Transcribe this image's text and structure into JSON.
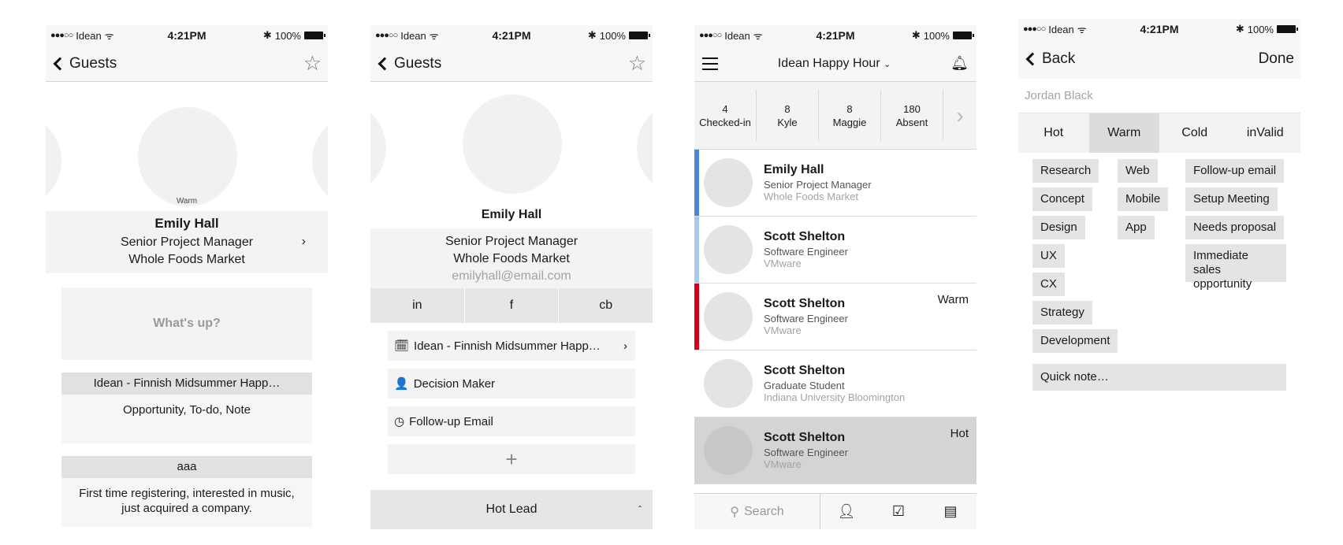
{
  "status": {
    "carrier": "Idean",
    "time": "4:21PM",
    "battery": "100%",
    "dots": "●●●○○"
  },
  "screen1": {
    "back_label": "Guests",
    "temperature_label": "Warm",
    "name": "Emily Hall",
    "title": "Senior Project Manager",
    "company": "Whole Foods Market",
    "whatsup": "What's up?",
    "event_card": {
      "head": "Idean - Finnish Midsummer Happ…",
      "body": "Opportunity, To-do, Note"
    },
    "note_card": {
      "head": "aaa",
      "body": "First time registering, interested in music, just acquired a company."
    }
  },
  "screen2": {
    "back_label": "Guests",
    "name": "Emily Hall",
    "title": "Senior Project Manager",
    "company": "Whole Foods Market",
    "email": "emilyhall@email.com",
    "social": [
      "in",
      "f",
      "cb"
    ],
    "rows": [
      {
        "icon": "calendar-icon",
        "glyph": "🗓",
        "label": "Idean - Finnish Midsummer Happ…"
      },
      {
        "icon": "person-icon",
        "glyph": "👤",
        "label": "Decision Maker"
      },
      {
        "icon": "clock-icon",
        "glyph": "◷",
        "label": "Follow-up Email"
      }
    ],
    "plus": "+",
    "bottom_label": "Hot Lead",
    "bottom_caret": "ˆ"
  },
  "screen3": {
    "title": "Idean Happy Hour",
    "stats": [
      {
        "value": "4",
        "label": "Checked-in"
      },
      {
        "value": "8",
        "label": "Kyle"
      },
      {
        "value": "8",
        "label": "Maggie"
      },
      {
        "value": "180",
        "label": "Absent"
      }
    ],
    "guests": [
      {
        "name": "Emily Hall",
        "role": "Senior Project Manager",
        "company": "Whole Foods Market",
        "tag": "",
        "bar": "#4a86d6"
      },
      {
        "name": "Scott Shelton",
        "role": "Software Engineer",
        "company": "VMware",
        "tag": "",
        "bar": "#a9c8ee"
      },
      {
        "name": "Scott Shelton",
        "role": "Software Engineer",
        "company": "VMware",
        "tag": "Warm",
        "bar": "#d0021b"
      },
      {
        "name": "Scott Shelton",
        "role": "Graduate Student",
        "company": "Indiana University Bloomington",
        "tag": "",
        "bar": ""
      },
      {
        "name": "Scott Shelton",
        "role": "Software Engineer",
        "company": "VMware",
        "tag": "Hot",
        "bar": ""
      }
    ],
    "search_label": "Search"
  },
  "screen4": {
    "back_label": "Back",
    "done_label": "Done",
    "contact": "Jordan Black",
    "temps": [
      "Hot",
      "Warm",
      "Cold",
      "inValid"
    ],
    "active_temp": "Warm",
    "tags_col1": [
      "Research",
      "Concept",
      "Design",
      "UX",
      "CX",
      "Strategy",
      "Development"
    ],
    "tags_col2": [
      "Web",
      "Mobile",
      "App"
    ],
    "tags_col3": [
      "Follow-up email",
      "Setup Meeting",
      "Needs proposal",
      "Immediate sales opportunity"
    ],
    "quick_note": "Quick note…"
  }
}
